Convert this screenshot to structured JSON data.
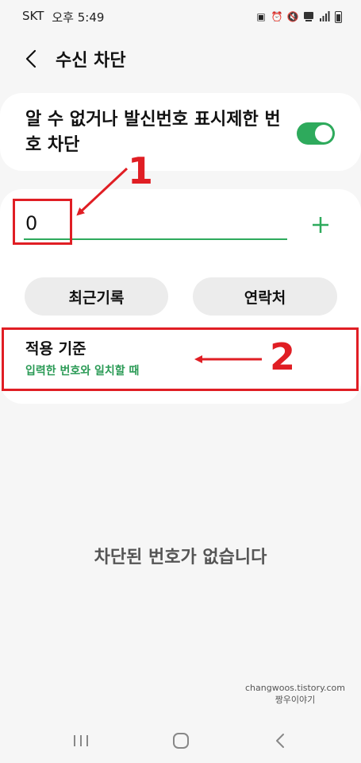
{
  "status_bar": {
    "carrier": "SKT",
    "time": "오후 5:49"
  },
  "header": {
    "title": "수신 차단"
  },
  "toggle_card": {
    "label": "알 수 없거나 발신번호 표시제한 번호 차단",
    "enabled": true
  },
  "number_input": {
    "value": "0"
  },
  "buttons": {
    "recent": "최근기록",
    "contacts": "연락처"
  },
  "criteria": {
    "title": "적용 기준",
    "value": "입력한 번호와 일치할 때"
  },
  "empty_state": {
    "text": "차단된 번호가 없습니다"
  },
  "annotations": {
    "marker_1": "1",
    "marker_2": "2"
  },
  "watermark": {
    "line1": "changwoos.tistory.com",
    "line2": "짱우이야기"
  },
  "colors": {
    "accent": "#2eaa5c",
    "annotation": "#e01e24"
  }
}
